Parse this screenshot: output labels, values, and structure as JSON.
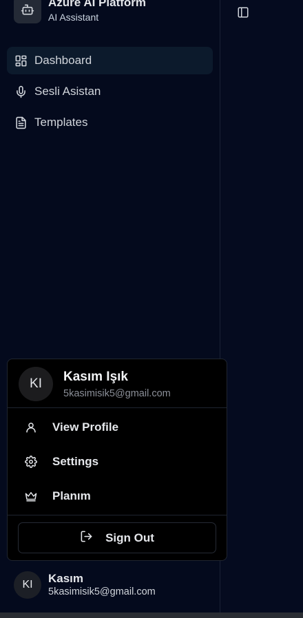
{
  "brand": {
    "title": "Azure AI Platform",
    "subtitle": "AI Assistant",
    "icon": "bot-icon"
  },
  "nav": {
    "items": [
      {
        "label": "Dashboard",
        "icon": "dashboard-icon",
        "active": true
      },
      {
        "label": "Sesli Asistan",
        "icon": "microphone-icon",
        "active": false
      },
      {
        "label": "Templates",
        "icon": "document-icon",
        "active": false
      }
    ]
  },
  "menu": {
    "avatar_initials": "KI",
    "name": "Kasım Işık",
    "email": "5kasimisik5@gmail.com",
    "items": [
      {
        "label": "View Profile",
        "icon": "user-icon"
      },
      {
        "label": "Settings",
        "icon": "gear-icon"
      },
      {
        "label": "Planım",
        "icon": "crown-icon"
      }
    ],
    "sign_out": {
      "label": "Sign Out",
      "icon": "logout-icon"
    }
  },
  "user": {
    "avatar_initials": "KI",
    "name": "Kasım",
    "email": "5kasimisik5@gmail.com"
  },
  "toolbar": {
    "toggle_icon": "sidebar-toggle-icon"
  },
  "colors": {
    "background": "#050b1f",
    "sidebar": "#040a1d",
    "active_item": "#0c1a2c",
    "menu_bg": "#000000"
  }
}
